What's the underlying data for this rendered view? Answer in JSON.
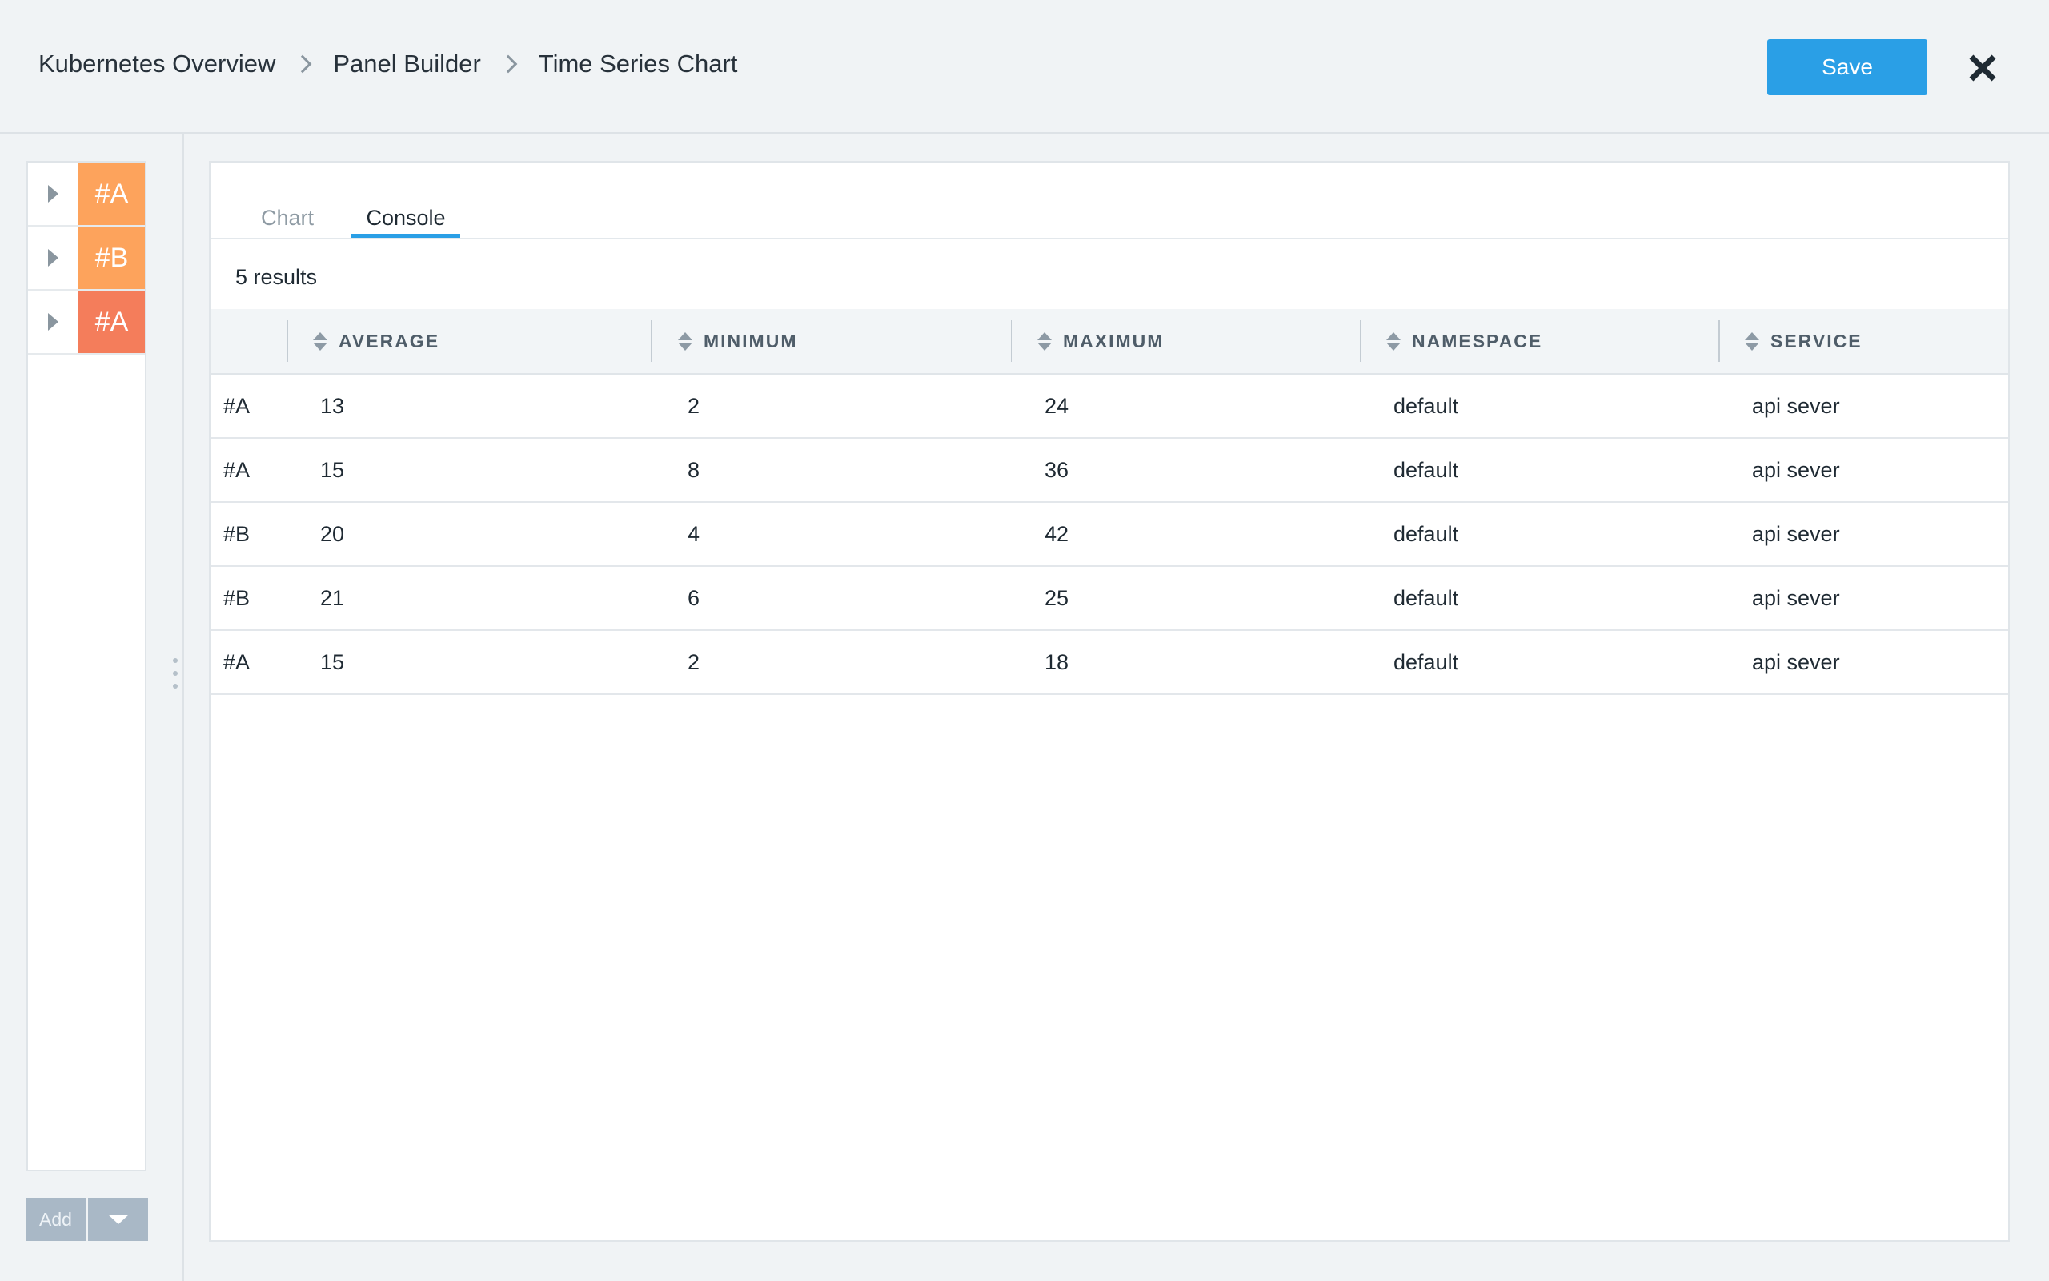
{
  "breadcrumb": [
    "Kubernetes Overview",
    "Panel Builder",
    "Time Series Chart"
  ],
  "header": {
    "save_label": "Save"
  },
  "queries": [
    {
      "label": "#A",
      "color": "#fda35c"
    },
    {
      "label": "#B",
      "color": "#fda35c"
    },
    {
      "label": "#A",
      "color": "#f47d5b"
    }
  ],
  "sidebar": {
    "add_label": "Add"
  },
  "tabs": {
    "chart": "Chart",
    "console": "Console",
    "active": "Console"
  },
  "results_label": "5 results",
  "table": {
    "columns": [
      "AVERAGE",
      "MINIMUM",
      "MAXIMUM",
      "NAMESPACE",
      "SERVICE"
    ],
    "rows": [
      [
        "#A",
        "13",
        "2",
        "24",
        "default",
        "api sever"
      ],
      [
        "#A",
        "15",
        "8",
        "36",
        "default",
        "api sever"
      ],
      [
        "#B",
        "20",
        "4",
        "42",
        "default",
        "api sever"
      ],
      [
        "#B",
        "21",
        "6",
        "25",
        "default",
        "api sever"
      ],
      [
        "#A",
        "15",
        "2",
        "18",
        "default",
        "api sever"
      ]
    ]
  },
  "colors": {
    "accent": "#2a9fe6"
  }
}
